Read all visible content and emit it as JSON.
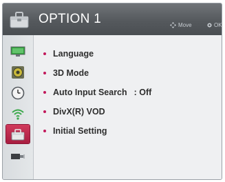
{
  "header": {
    "title": "OPTION 1",
    "hint_move_label": "Move",
    "hint_ok_label": "OK"
  },
  "sidebar": {
    "items": [
      {
        "icon": "picture-icon"
      },
      {
        "icon": "sound-icon"
      },
      {
        "icon": "time-icon"
      },
      {
        "icon": "network-icon"
      },
      {
        "icon": "option-icon",
        "active": true
      },
      {
        "icon": "input-icon"
      }
    ]
  },
  "menu": {
    "items": [
      {
        "label": "Language",
        "value": ""
      },
      {
        "label": "3D Mode",
        "value": ""
      },
      {
        "label": "Auto Input Search",
        "value": ": Off"
      },
      {
        "label": "DivX(R) VOD",
        "value": ""
      },
      {
        "label": "Initial Setting",
        "value": ""
      }
    ]
  },
  "colors": {
    "accent": "#c2185b",
    "header": "#5a5e62",
    "active_tab": "#b52248"
  }
}
